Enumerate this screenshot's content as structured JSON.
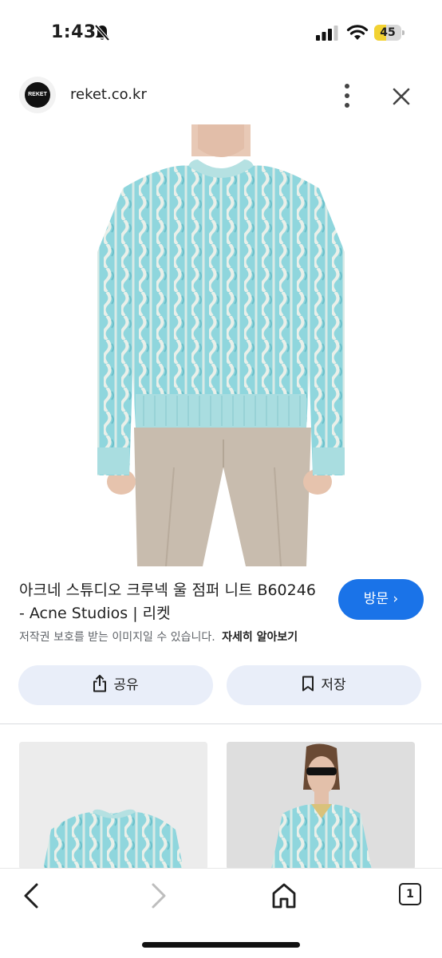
{
  "status_bar": {
    "time": "1:43",
    "battery_level": "45",
    "battery_percent": 45,
    "icons": [
      "bell-slash-icon",
      "cellular-signal-icon",
      "wifi-icon",
      "battery-icon"
    ]
  },
  "site": {
    "logo_text": "REKET",
    "domain": "reket.co.kr"
  },
  "product": {
    "title": "아크네 스튜디오 크루넥 울 점퍼 니트 B60246 - Acne Studios | 리켓",
    "copyright_note": "저작권 보호를 받는 이미지일 수 있습니다.",
    "learn_more": "자세히 알아보기",
    "visit_label": "방문 ›"
  },
  "actions": {
    "share_label": "공유",
    "save_label": "저장"
  },
  "toolbar": {
    "tab_count": "1"
  },
  "colors": {
    "accent": "#1a73e8",
    "action_button_bg": "#e9eef9",
    "sweater": "#8fd6dd",
    "trousers": "#c8bcae",
    "battery_fill": "#f2d233"
  }
}
